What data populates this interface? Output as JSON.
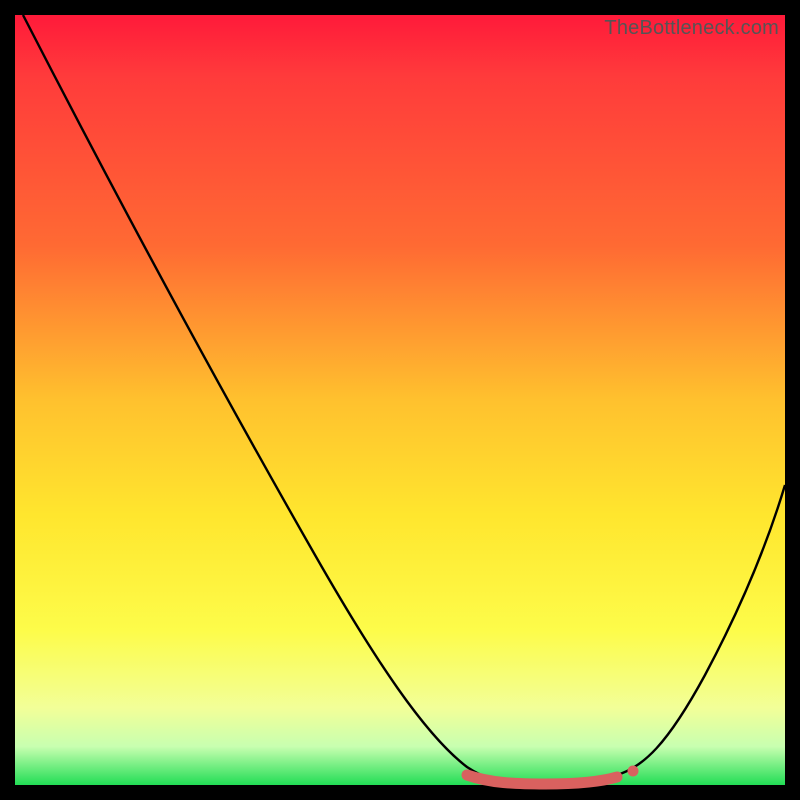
{
  "watermark": "TheBottleneck.com",
  "colors": {
    "gradient_top": "#ff1a3a",
    "gradient_mid1": "#ff6a33",
    "gradient_mid2": "#ffe62e",
    "gradient_bottom": "#22dd55",
    "curve_stroke": "#000000",
    "accent_dot": "#d9615f",
    "accent_band": "#d9615f",
    "frame": "#000000"
  },
  "chart_data": {
    "type": "line",
    "title": "",
    "xlabel": "",
    "ylabel": "",
    "xlim": [
      0,
      100
    ],
    "ylim": [
      0,
      100
    ],
    "grid": false,
    "series": [
      {
        "name": "bottleneck-curve",
        "x": [
          0,
          5,
          10,
          15,
          20,
          25,
          30,
          35,
          40,
          45,
          50,
          55,
          58,
          62,
          66,
          70,
          74,
          78,
          82,
          86,
          90,
          95,
          100
        ],
        "y": [
          100,
          94,
          87,
          80,
          72,
          64,
          56,
          48,
          40,
          32,
          23,
          14,
          7,
          2,
          0,
          0,
          0,
          1,
          4,
          10,
          18,
          29,
          42
        ]
      }
    ],
    "annotations": {
      "minimum_band_x": [
        58,
        80
      ],
      "accent_dot_x": 80
    }
  }
}
